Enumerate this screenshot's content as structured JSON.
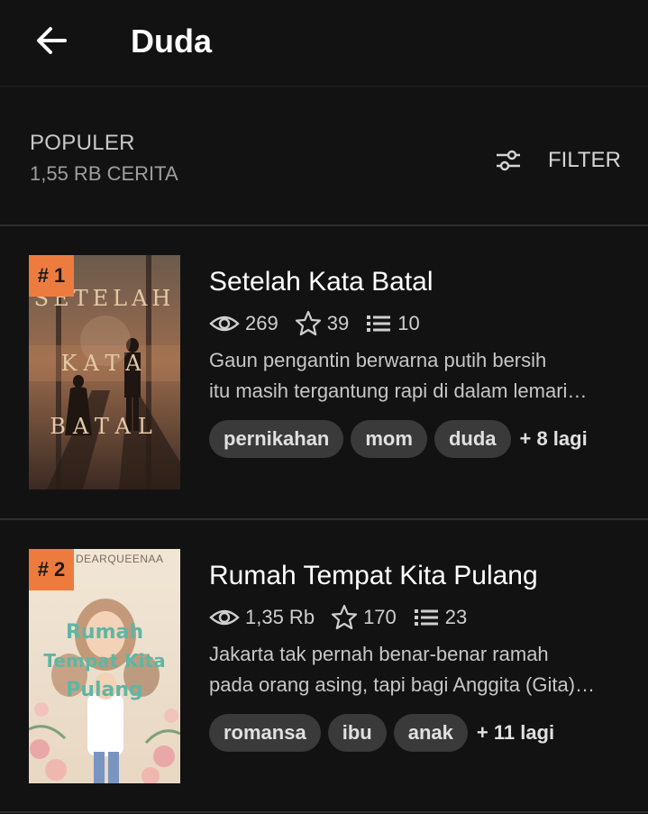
{
  "header": {
    "title": "Duda",
    "back_icon": "arrow-left-icon"
  },
  "sort": {
    "label": "POPULER",
    "count": "1,55 RB CERITA",
    "filter_label": "FILTER",
    "filter_icon": "sliders-icon"
  },
  "colors": {
    "background": "#121212",
    "rank_badge": "#ee7b3e",
    "tag_bg": "#3a3a3a"
  },
  "stories": [
    {
      "rank": "# 1",
      "cover_text": {
        "top": "SETELAH",
        "middle": "KATA",
        "bottom": "BATAL"
      },
      "title": "Setelah Kata Batal",
      "reads": "269",
      "votes": "39",
      "parts": "10",
      "desc_line1": "Gaun pengantin berwarna putih bersih",
      "desc_line2": "itu masih tergantung rapi di dalam lemari…",
      "tags": [
        "pernikahan",
        "mom",
        "duda"
      ],
      "more": "+ 8 lagi"
    },
    {
      "rank": "# 2",
      "cover_text": {
        "author": "DEARQUEENAA",
        "line1": "Rumah",
        "line2": "Tempat Kita",
        "line3": "Pulang"
      },
      "title": "Rumah Tempat Kita Pulang",
      "reads": "1,35 Rb",
      "votes": "170",
      "parts": "23",
      "desc_line1": "Jakarta tak pernah benar-benar ramah",
      "desc_line2": "pada orang asing, tapi bagi Anggita (Gita)…",
      "tags": [
        "romansa",
        "ibu",
        "anak"
      ],
      "more": "+ 11 lagi"
    }
  ]
}
